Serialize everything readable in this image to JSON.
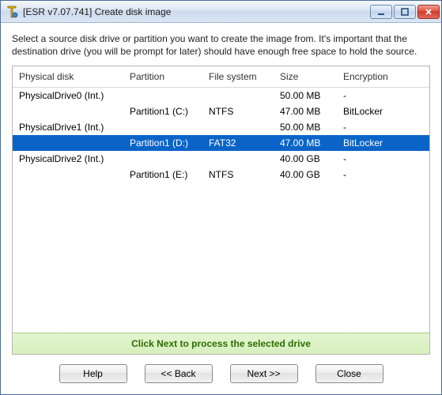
{
  "window": {
    "title": "[ESR v7.07.741]  Create disk image"
  },
  "instruction": "Select a source disk drive or partition you want to create the image from. It's important that the destination drive (you will be prompt for later) should have enough free space to hold the source.",
  "columns": {
    "physical": "Physical disk",
    "partition": "Partition",
    "filesystem": "File system",
    "size": "Size",
    "encryption": "Encryption"
  },
  "rows": [
    {
      "physical": "PhysicalDrive0 (Int.)",
      "partition": "",
      "filesystem": "",
      "size": "50.00 MB",
      "encryption": "-",
      "selected": false
    },
    {
      "physical": "",
      "partition": "Partition1 (C:)",
      "filesystem": "NTFS",
      "size": "47.00 MB",
      "encryption": "BitLocker",
      "selected": false
    },
    {
      "physical": "PhysicalDrive1 (Int.)",
      "partition": "",
      "filesystem": "",
      "size": "50.00 MB",
      "encryption": "-",
      "selected": false
    },
    {
      "physical": "",
      "partition": "Partition1 (D:)",
      "filesystem": "FAT32",
      "size": "47.00 MB",
      "encryption": "BitLocker",
      "selected": true
    },
    {
      "physical": "PhysicalDrive2 (Int.)",
      "partition": "",
      "filesystem": "",
      "size": "40.00 GB",
      "encryption": "-",
      "selected": false
    },
    {
      "physical": "",
      "partition": "Partition1 (E:)",
      "filesystem": "NTFS",
      "size": "40.00 GB",
      "encryption": "-",
      "selected": false
    }
  ],
  "hint": "Click Next to process the selected drive",
  "buttons": {
    "help": "Help",
    "back": "<< Back",
    "next": "Next >>",
    "close": "Close"
  }
}
